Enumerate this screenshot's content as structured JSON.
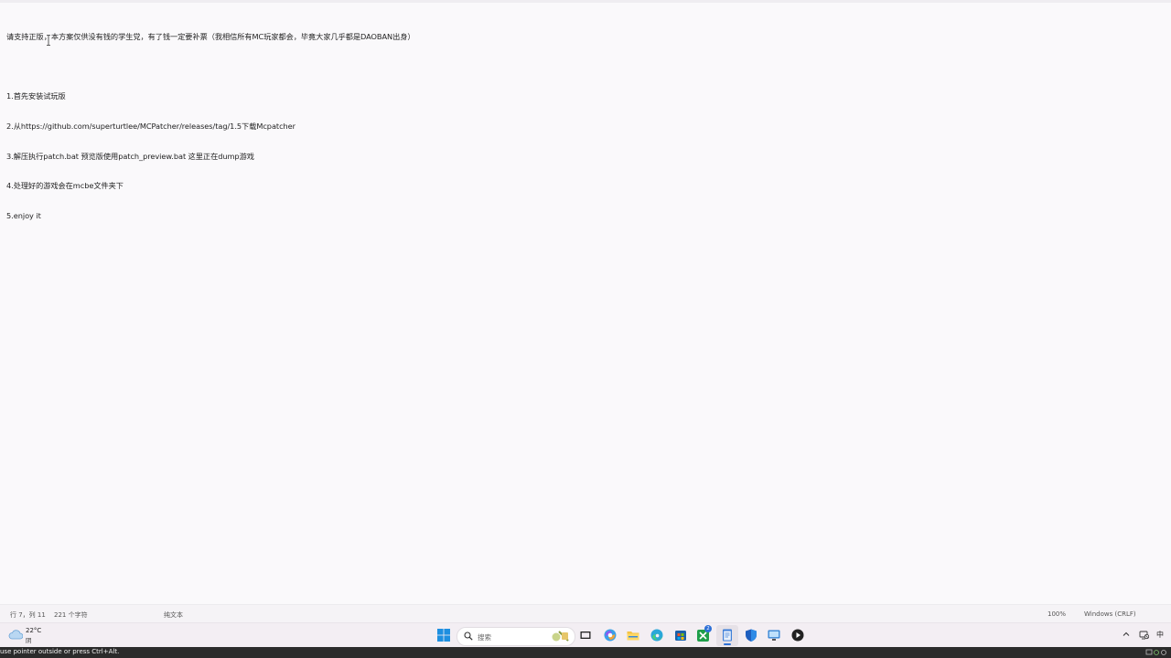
{
  "editor": {
    "lines": [
      "请支持正版，本方案仅供没有钱的学生党，有了钱一定要补票（我相信所有MC玩家都会，毕竟大家几乎都是DAOBAN出身）",
      "",
      "1.首先安装试玩版",
      "2.从https://github.com/superturtlee/MCPatcher/releases/tag/1.5下载Mcpatcher",
      "3.解压执行patch.bat 预览版使用patch_preview.bat 这里正在dump游戏",
      "4.处理好的游戏会在mcbe文件夹下",
      "5.enjoy it"
    ]
  },
  "statusbar": {
    "position": "行 7，列 11",
    "char_count": "221 个字符",
    "file_type": "纯文本",
    "zoom": "100%",
    "line_ending": "Windows (CRLF)"
  },
  "taskbar": {
    "weather_temp": "22°C",
    "weather_condition": "阴",
    "search_placeholder": "搜索",
    "ime_indicator": "中",
    "apps": [
      {
        "icon": "start-windows-icon"
      },
      {
        "icon": "task-view-icon"
      },
      {
        "icon": "copilot-icon"
      },
      {
        "icon": "file-explorer-icon"
      },
      {
        "icon": "edge-browser-icon"
      },
      {
        "icon": "microsoft-store-icon"
      },
      {
        "icon": "xbox-icon",
        "badge": "2"
      },
      {
        "icon": "notepad-icon"
      },
      {
        "icon": "defender-icon"
      },
      {
        "icon": "remote-desktop-icon"
      },
      {
        "icon": "media-player-icon"
      }
    ]
  },
  "vm_bar": {
    "hint": "use pointer outside or press Ctrl+Alt."
  },
  "colors": {
    "background": "#faf9fb",
    "taskbar": "#f3eef3",
    "text": "#1f1f1f"
  }
}
